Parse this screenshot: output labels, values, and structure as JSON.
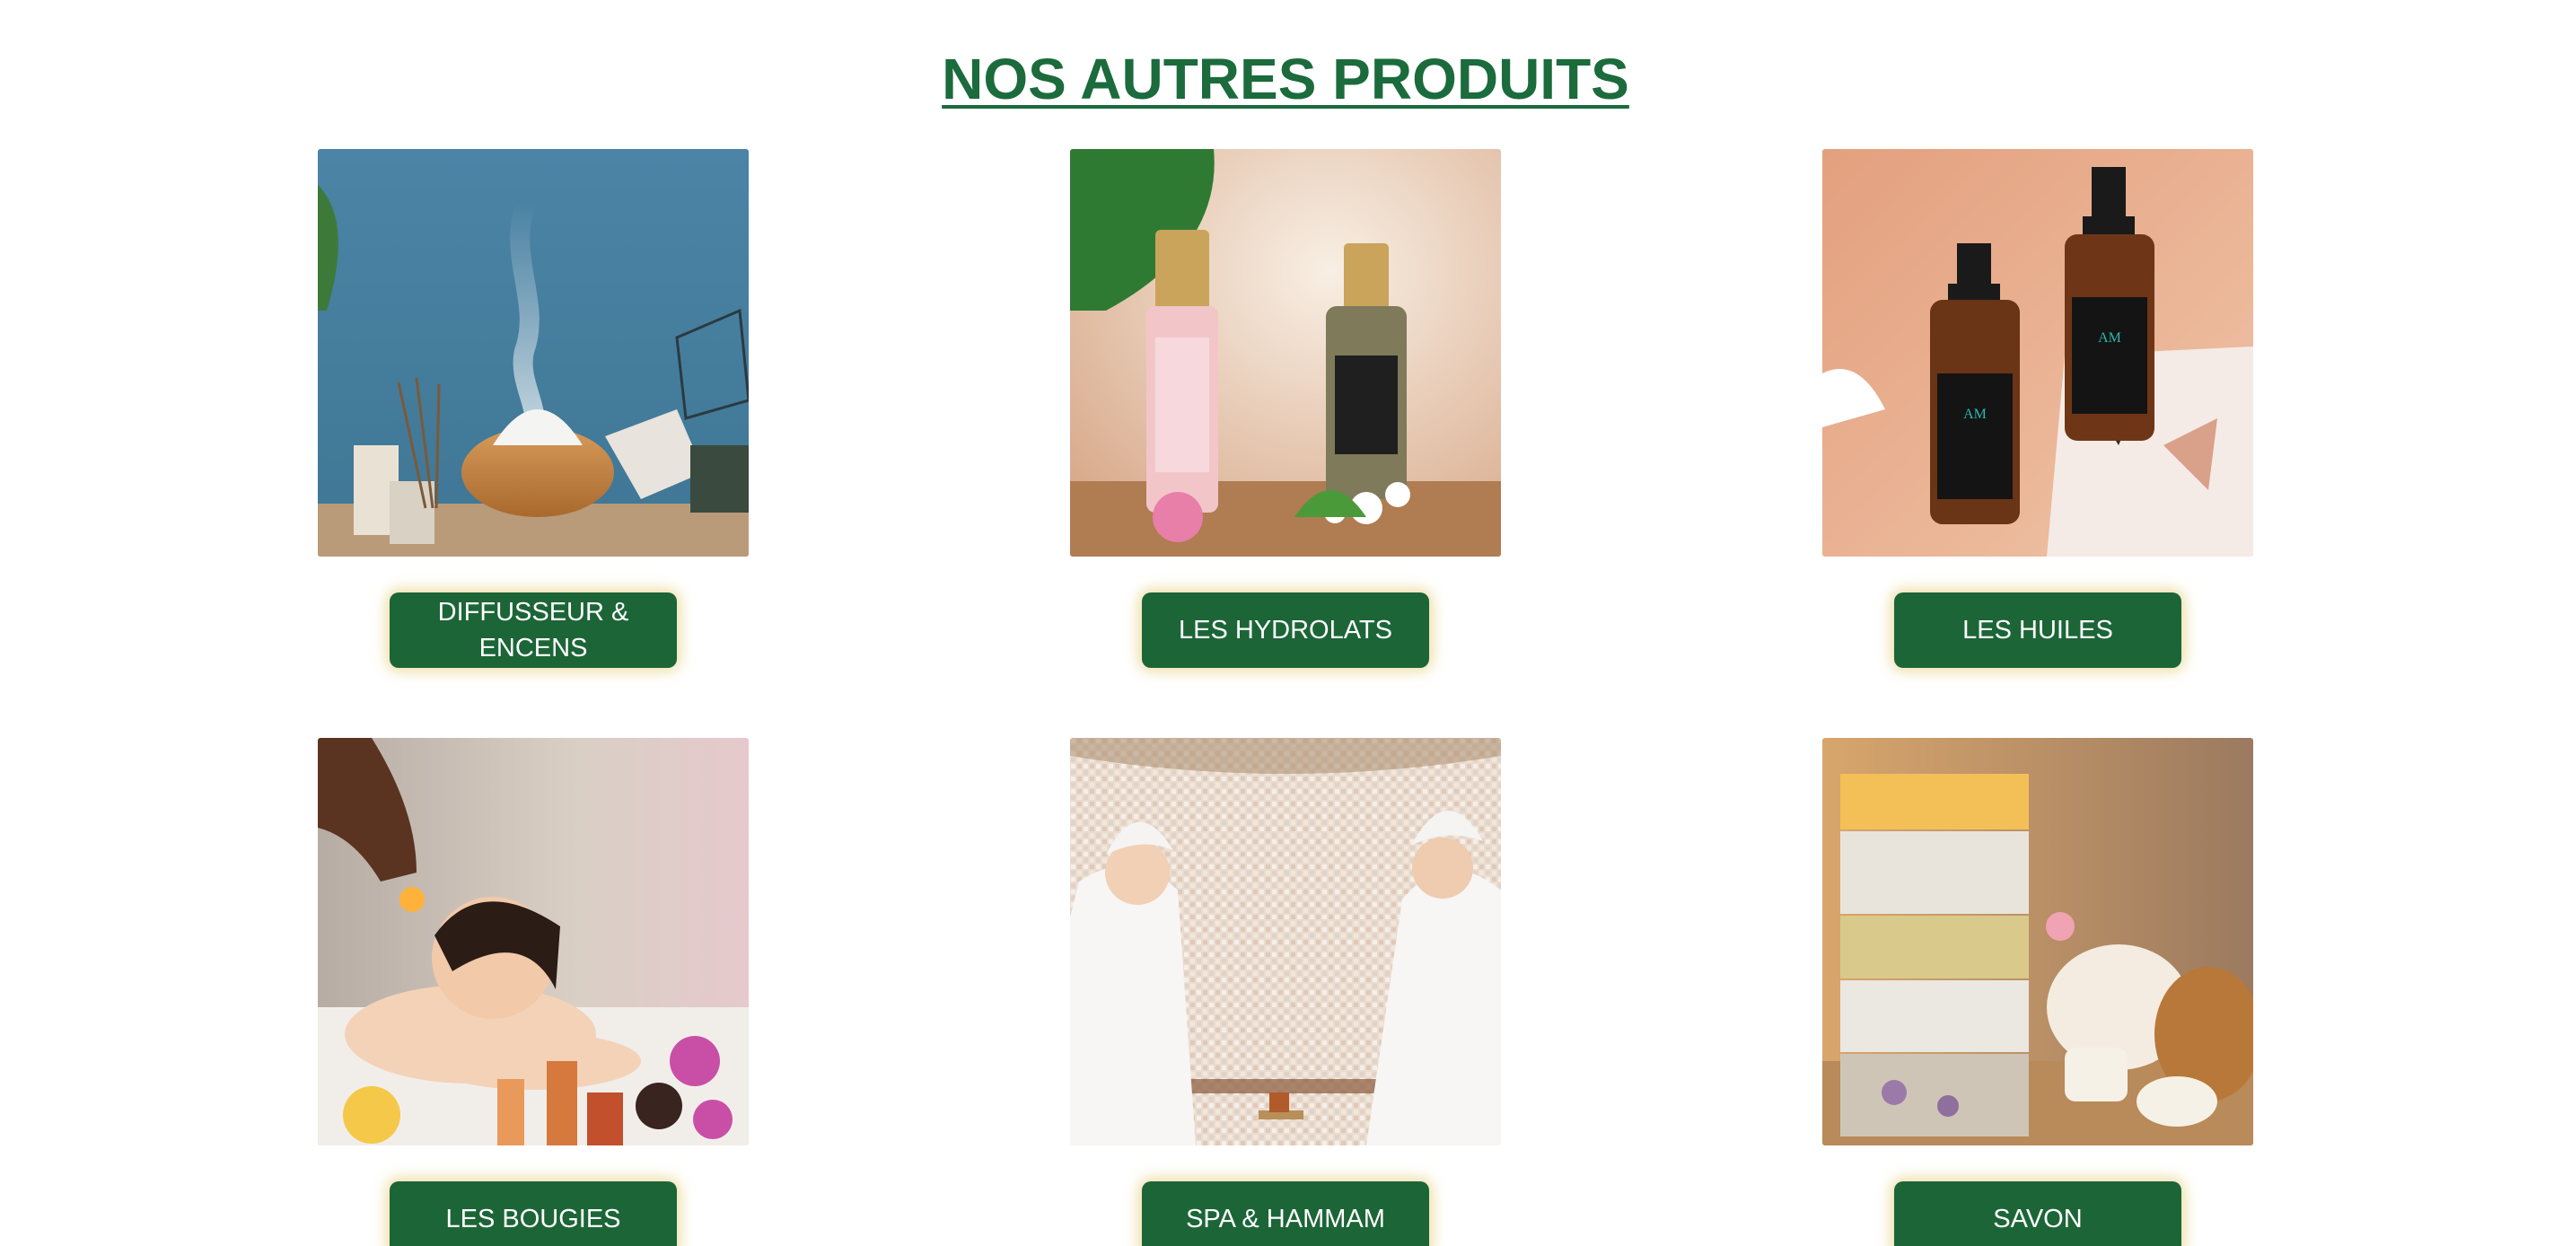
{
  "section": {
    "title": "NOS AUTRES PRODUITS"
  },
  "products": [
    {
      "label": "DIFFUSSEUR & ENCENS",
      "image_icon": "diffuser-photo"
    },
    {
      "label": "LES HYDROLATS",
      "image_icon": "hydrolats-photo"
    },
    {
      "label": "LES HUILES",
      "image_icon": "oils-photo"
    },
    {
      "label": "LES BOUGIES",
      "image_icon": "candles-photo"
    },
    {
      "label": "SPA & HAMMAM",
      "image_icon": "spa-hammam-photo"
    },
    {
      "label": "SAVON",
      "image_icon": "soap-photo"
    }
  ],
  "colors": {
    "title_green": "#1b6b3c",
    "button_green": "#1c6537",
    "button_glow": "#e4ce78",
    "button_text": "#ffffff"
  }
}
